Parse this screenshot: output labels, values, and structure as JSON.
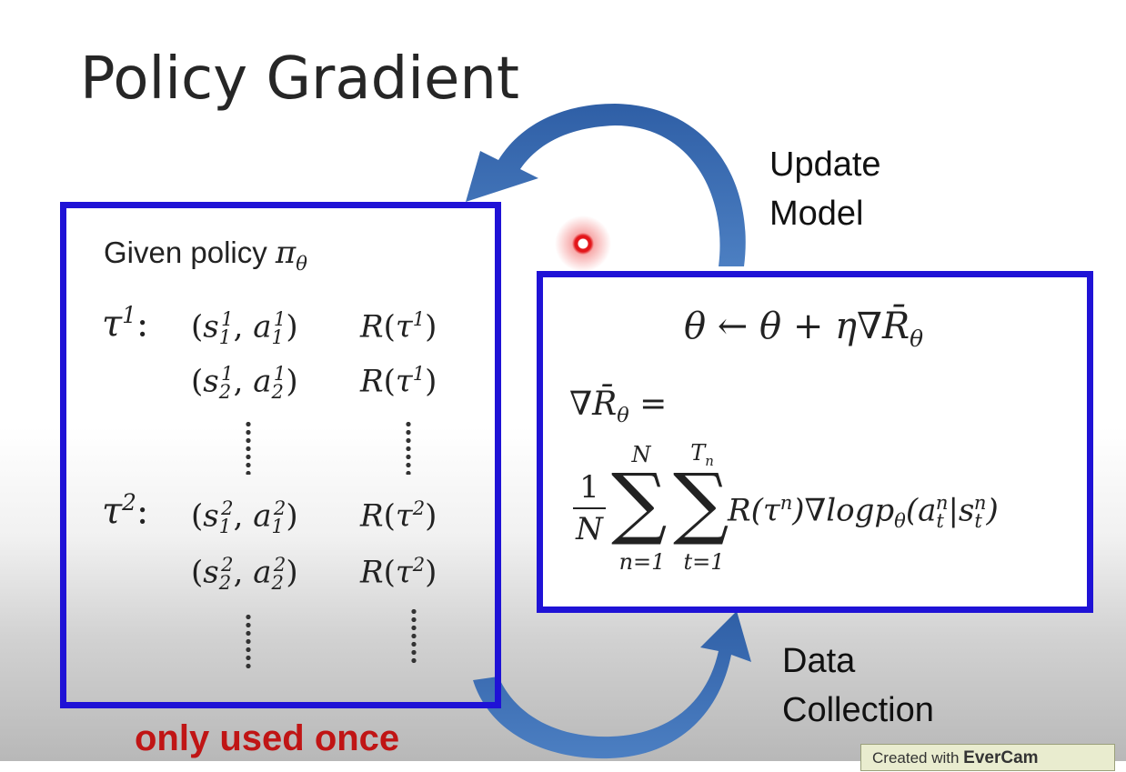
{
  "slide": {
    "title": "Policy Gradient",
    "left_box": {
      "given_text": "Given policy ",
      "policy_symbol": "π",
      "policy_subscript": "θ",
      "trajectories": [
        {
          "tau_label": "τ",
          "tau_sup": "1",
          "steps": [
            {
              "s_sub": "1",
              "s_sup": "1",
              "a_sub": "1",
              "a_sup": "1",
              "reward_sup": "1"
            },
            {
              "s_sub": "2",
              "s_sup": "1",
              "a_sub": "2",
              "a_sup": "1",
              "reward_sup": "1"
            }
          ]
        },
        {
          "tau_label": "τ",
          "tau_sup": "2",
          "steps": [
            {
              "s_sub": "1",
              "s_sup": "2",
              "a_sub": "1",
              "a_sup": "2",
              "reward_sup": "2"
            },
            {
              "s_sub": "2",
              "s_sup": "2",
              "a_sub": "2",
              "a_sup": "2",
              "reward_sup": "2"
            }
          ]
        }
      ]
    },
    "right_box": {
      "update_rule": "θ ← θ + η∇R̄",
      "update_rule_sub": "θ",
      "gradient_lhs": "∇R̄",
      "gradient_lhs_sub": "θ",
      "gradient_equals": "=",
      "frac_num": "1",
      "frac_den": "N",
      "sum1_upper": "N",
      "sum1_lower": "n=1",
      "sum2_upper": "T",
      "sum2_upper_sub": "n",
      "sum2_lower": "t=1",
      "summand": "R(τ",
      "summand_sup": "n",
      "summand_mid": ")∇logp",
      "summand_sub": "θ",
      "summand_args_open": "(a",
      "a_sub": "t",
      "a_sup": "n",
      "bar_s": "|s",
      "s_sub": "t",
      "s_sup": "n",
      "summand_close": ")"
    },
    "labels": {
      "update_line1": "Update",
      "update_line2": "Model",
      "data_line1": "Data",
      "data_line2": "Collection",
      "only_used_once": "only used once"
    },
    "watermark": {
      "prefix": "Created with ",
      "brand": "EverCam"
    },
    "colors": {
      "box_border": "#1f12d6",
      "arrow_fill": "#3a6ab0",
      "emphasis_red": "#c01515",
      "laser_pointer": "#e3171b"
    }
  }
}
